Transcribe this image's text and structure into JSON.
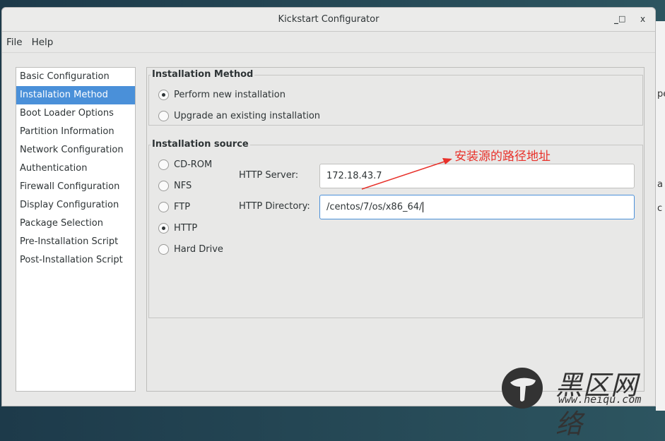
{
  "window": {
    "title": "Kickstart Configurator",
    "controls": [
      "_",
      "□",
      "x"
    ]
  },
  "menu": [
    "File",
    "Help"
  ],
  "sidebar": {
    "items": [
      "Basic Configuration",
      "Installation Method",
      "Boot Loader Options",
      "Partition Information",
      "Network Configuration",
      "Authentication",
      "Firewall Configuration",
      "Display Configuration",
      "Package Selection",
      "Pre-Installation Script",
      "Post-Installation Script"
    ],
    "selected": 1
  },
  "method": {
    "title": "Installation Method",
    "options": [
      "Perform new installation",
      "Upgrade an existing installation"
    ],
    "selected": 0
  },
  "source": {
    "title": "Installation source",
    "options": [
      "CD-ROM",
      "NFS",
      "FTP",
      "HTTP",
      "Hard Drive"
    ],
    "selected": 3,
    "server_label": "HTTP Server:",
    "server_value": "172.18.43.7",
    "dir_label": "HTTP Directory:",
    "dir_value": "/centos/7/os/x86_64/"
  },
  "annotation": {
    "text": "安装源的路径地址",
    "color": "#e8312a"
  },
  "watermark": {
    "text": "黑区网络",
    "url": "www.heiqu.com"
  },
  "background_fragments": [
    "pe",
    "a",
    "c"
  ]
}
